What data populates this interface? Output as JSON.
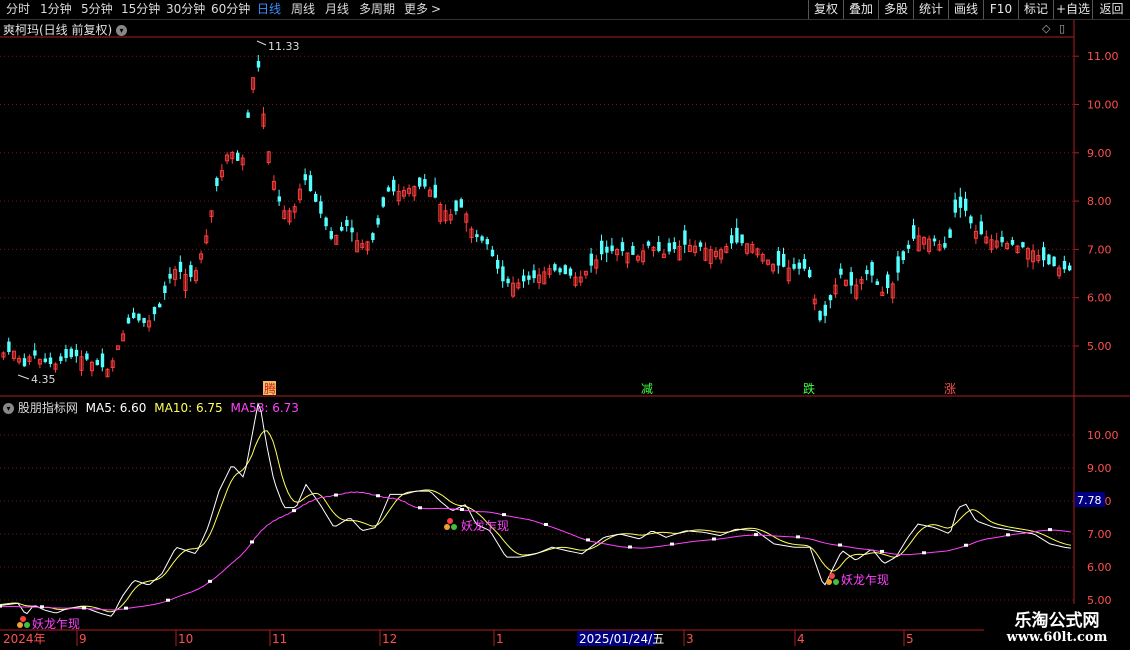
{
  "toolbar": {
    "periods": [
      "分时",
      "1分钟",
      "5分钟",
      "15分钟",
      "30分钟",
      "60分钟",
      "日线",
      "周线",
      "月线",
      "多周期",
      "更多"
    ],
    "active_period": "日线",
    "more_arrow": ">",
    "right_buttons": [
      "复权",
      "叠加",
      "多股",
      "统计",
      "画线",
      "F10",
      "标记",
      "+自选",
      "返回"
    ]
  },
  "main_panel": {
    "title": "爽柯玛(日线 前复权)",
    "max_label": "11.33",
    "min_label": "4.35",
    "y_ticks": [
      "11.00",
      "10.00",
      "9.00",
      "8.00",
      "7.00",
      "6.00",
      "5.00"
    ],
    "signals": [
      "腾",
      "减",
      "跌",
      "涨"
    ]
  },
  "indicator_panel": {
    "name": "股朋指标网",
    "ma5_label": "MA5: 6.60",
    "ma10_label": "MA10: 6.75",
    "ma58_label": "MA58: 6.73",
    "y_ticks": [
      "10.00",
      "9.00",
      "8.00",
      "7.00",
      "6.00",
      "5.00"
    ],
    "current_value": "7.78",
    "annotations": [
      "妖龙乍现",
      "妖龙乍现",
      "妖龙乍现"
    ]
  },
  "date_axis": {
    "year_label": "2024年",
    "months": [
      "9",
      "10",
      "11",
      "12",
      "1",
      "2",
      "3",
      "4",
      "5"
    ],
    "cursor_date": "2025/01/24/五"
  },
  "watermark": {
    "site_name": "乐淘公式网",
    "url": "www.60lt.com"
  },
  "colors": {
    "up": "#ff3c3c",
    "down": "#54ffff",
    "ma5": "#ffffff",
    "ma10": "#ffff5a",
    "ma58": "#ff44ff",
    "active_tab": "#3b8eff"
  }
}
